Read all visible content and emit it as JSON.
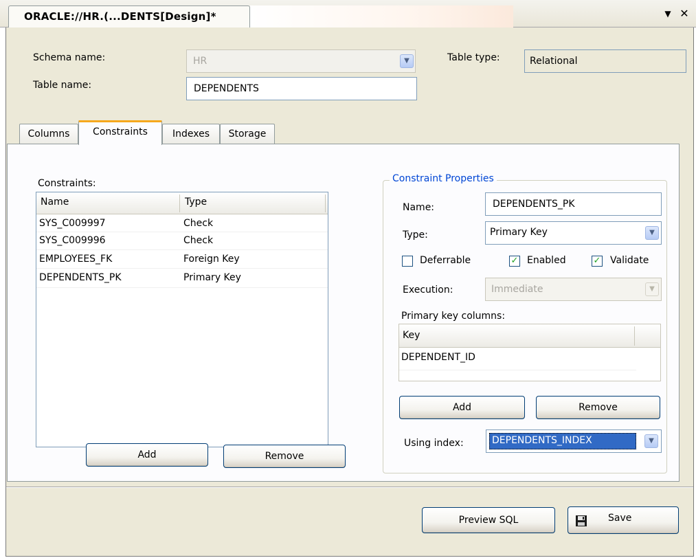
{
  "window": {
    "tab_title": "ORACLE://HR.(...DENTS[Design]*",
    "dropdown_glyph": "▼",
    "close_glyph": "✕"
  },
  "header": {
    "schema_label": "Schema name:",
    "schema_value": "HR",
    "table_type_label": "Table type:",
    "table_type_value": "Relational",
    "table_name_label": "Table name:",
    "table_name_value": "DEPENDENTS"
  },
  "tabs": [
    {
      "label": "Columns",
      "active": false
    },
    {
      "label": "Constraints",
      "active": true
    },
    {
      "label": "Indexes",
      "active": false
    },
    {
      "label": "Storage",
      "active": false
    }
  ],
  "constraints": {
    "section_label": "Constraints:",
    "columns": [
      "Name",
      "Type"
    ],
    "rows": [
      {
        "name": "SYS_C009997",
        "type": "Check"
      },
      {
        "name": "SYS_C009996",
        "type": "Check"
      },
      {
        "name": "EMPLOYEES_FK",
        "type": "Foreign Key"
      },
      {
        "name": "DEPENDENTS_PK",
        "type": "Primary Key"
      }
    ],
    "add_label": "Add",
    "remove_label": "Remove"
  },
  "properties": {
    "group_title": "Constraint Properties",
    "name_label": "Name:",
    "name_value": "DEPENDENTS_PK",
    "type_label": "Type:",
    "type_value": "Primary Key",
    "deferrable_label": "Deferrable",
    "deferrable_checked": false,
    "enabled_label": "Enabled",
    "enabled_checked": true,
    "validate_label": "Validate",
    "validate_checked": true,
    "execution_label": "Execution:",
    "execution_value": "Immediate",
    "pk_columns_label": "Primary key columns:",
    "pk_columns_header": "Key",
    "pk_columns": [
      "DEPENDENT_ID"
    ],
    "add_label": "Add",
    "remove_label": "Remove",
    "using_index_label": "Using index:",
    "using_index_value": "DEPENDENTS_INDEX"
  },
  "footer": {
    "preview_sql_label": "Preview SQL",
    "save_label": "Save"
  },
  "icons": {
    "save": "floppy-disk-icon",
    "combo_arrow": "chevron-down-icon"
  },
  "colors": {
    "window_bg": "#ece9d8",
    "active_tab_accent": "#f6a81d",
    "group_title": "#0046d5",
    "selection": "#316ac5"
  }
}
